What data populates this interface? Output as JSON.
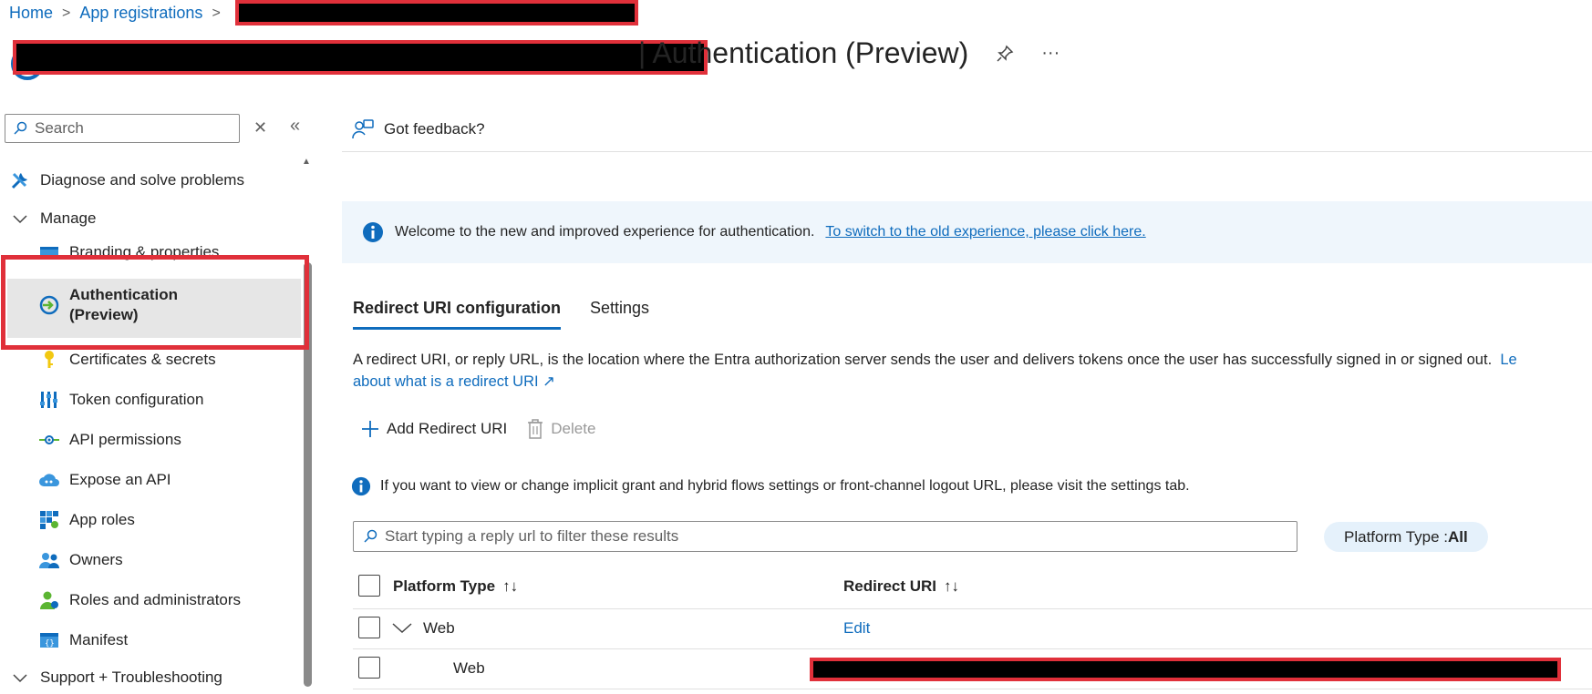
{
  "breadcrumb": {
    "home": "Home",
    "app_registrations": "App registrations",
    "separator": ">"
  },
  "title": {
    "suffix": "| Authentication (Preview)",
    "pin": "📌",
    "more": "···"
  },
  "sidebar": {
    "search_placeholder": "Search",
    "clear": "✕",
    "collapse": "«",
    "items": [
      {
        "label": "Diagnose and solve problems",
        "icon": "wrench-icon"
      },
      {
        "label": "Manage",
        "icon": "chevron-down-icon"
      },
      {
        "label": "Branding & properties",
        "icon": "branding-icon"
      },
      {
        "label": "Authentication",
        "label2": "(Preview)",
        "icon": "authentication-icon"
      },
      {
        "label": "Certificates & secrets",
        "icon": "key-icon"
      },
      {
        "label": "Token configuration",
        "icon": "token-icon"
      },
      {
        "label": "API permissions",
        "icon": "api-permissions-icon"
      },
      {
        "label": "Expose an API",
        "icon": "cloud-icon"
      },
      {
        "label": "App roles",
        "icon": "app-roles-icon"
      },
      {
        "label": "Owners",
        "icon": "owners-icon"
      },
      {
        "label": "Roles and administrators",
        "icon": "roles-icon"
      },
      {
        "label": "Manifest",
        "icon": "manifest-icon"
      },
      {
        "label": "Support + Troubleshooting",
        "icon": "chevron-down-icon"
      }
    ]
  },
  "main": {
    "feedback": "Got feedback?",
    "banner": {
      "text": "Welcome to the new and improved experience for authentication.",
      "link": "To switch to the old experience, please click here."
    },
    "tabs": [
      "Redirect URI configuration",
      "Settings"
    ],
    "description": {
      "line1": "A redirect URI, or reply URL, is the location where the Entra authorization server sends the user and delivers tokens once the user has successfully signed in or signed out.",
      "line1_link": "Le",
      "line2_link": "about what is a redirect URI"
    },
    "toolbar": {
      "add": "Add Redirect URI",
      "delete": "Delete"
    },
    "info": "If you want to view or change implicit grant and hybrid flows settings or front-channel logout URL, please visit the settings tab.",
    "filter_placeholder": "Start typing a reply url to filter these results",
    "platform_pill": {
      "label": "Platform Type : ",
      "value": "All"
    },
    "table": {
      "headers": [
        "Platform Type",
        "Redirect URI"
      ],
      "sort_icon": "↑↓",
      "rows": [
        {
          "platform": "Web",
          "action": "Edit"
        },
        {
          "platform": "Web"
        }
      ]
    }
  },
  "colors": {
    "accent": "#0f6cbd",
    "banner_bg": "#eff6fc",
    "highlight_border": "#e0303a"
  }
}
